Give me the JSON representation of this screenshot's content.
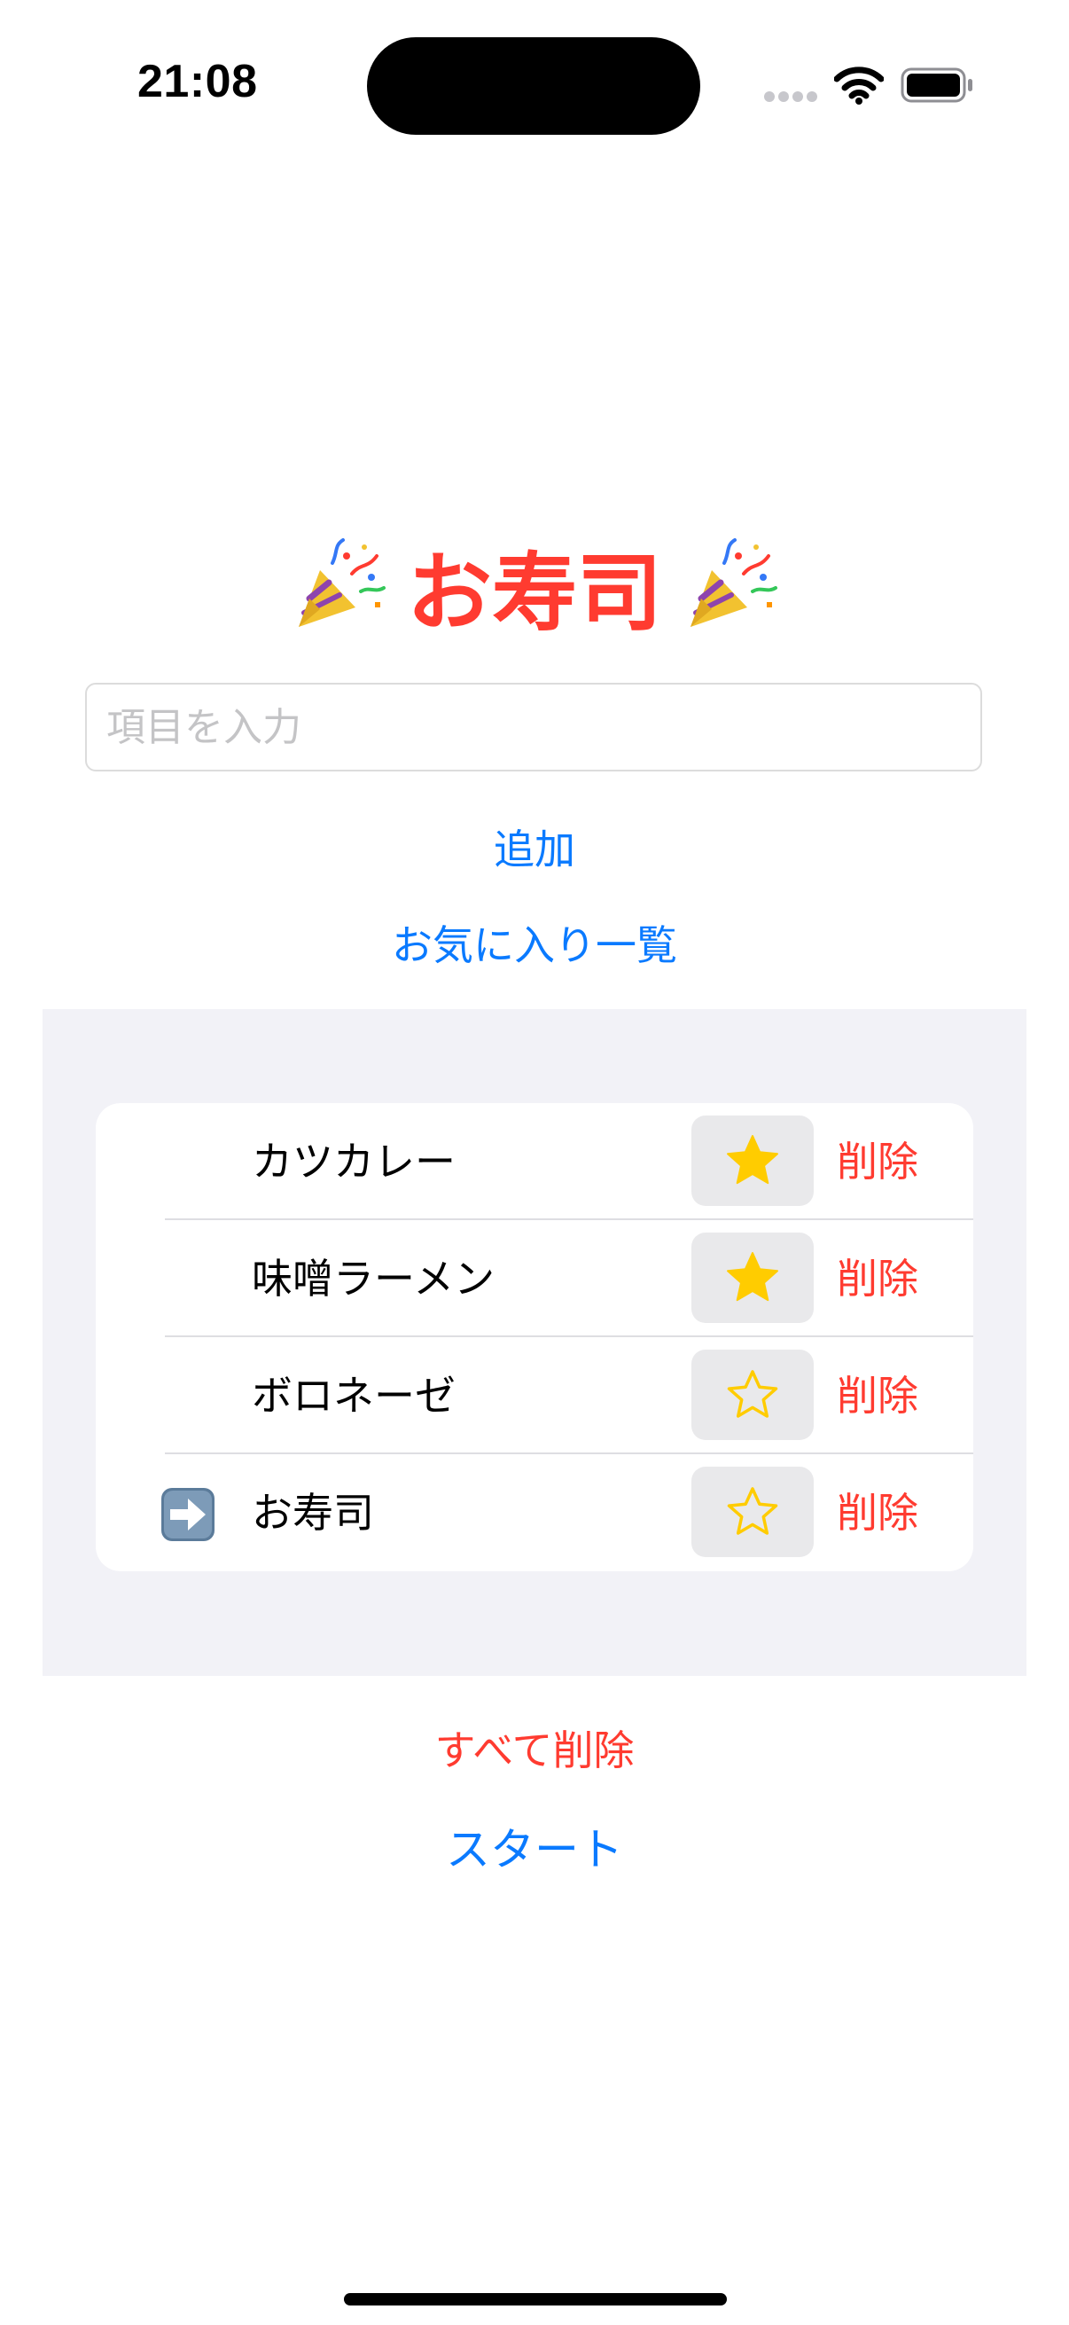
{
  "status_bar": {
    "time": "21:08"
  },
  "title": {
    "text": "お寿司"
  },
  "input": {
    "placeholder": "項目を入力",
    "value": ""
  },
  "buttons": {
    "add": "追加",
    "favorites": "お気に入り一覧",
    "delete_all": "すべて削除",
    "start": "スタート"
  },
  "items": [
    {
      "label": "カツカレー",
      "favorite": true,
      "current": false,
      "delete_label": "削除"
    },
    {
      "label": "味噌ラーメン",
      "favorite": true,
      "current": false,
      "delete_label": "削除"
    },
    {
      "label": "ボロネーゼ",
      "favorite": false,
      "current": false,
      "delete_label": "削除"
    },
    {
      "label": "お寿司",
      "favorite": false,
      "current": true,
      "delete_label": "削除"
    }
  ],
  "icons": {
    "title_decoration": "party-popper-icon",
    "star_filled": "star-filled-icon",
    "star_outline": "star-outline-icon",
    "current_marker": "arrow-right-icon"
  },
  "colors": {
    "accent": "#0A7AFF",
    "destructive": "#FF3B30",
    "star": "#FFCC00",
    "list_background": "#F2F2F7"
  }
}
